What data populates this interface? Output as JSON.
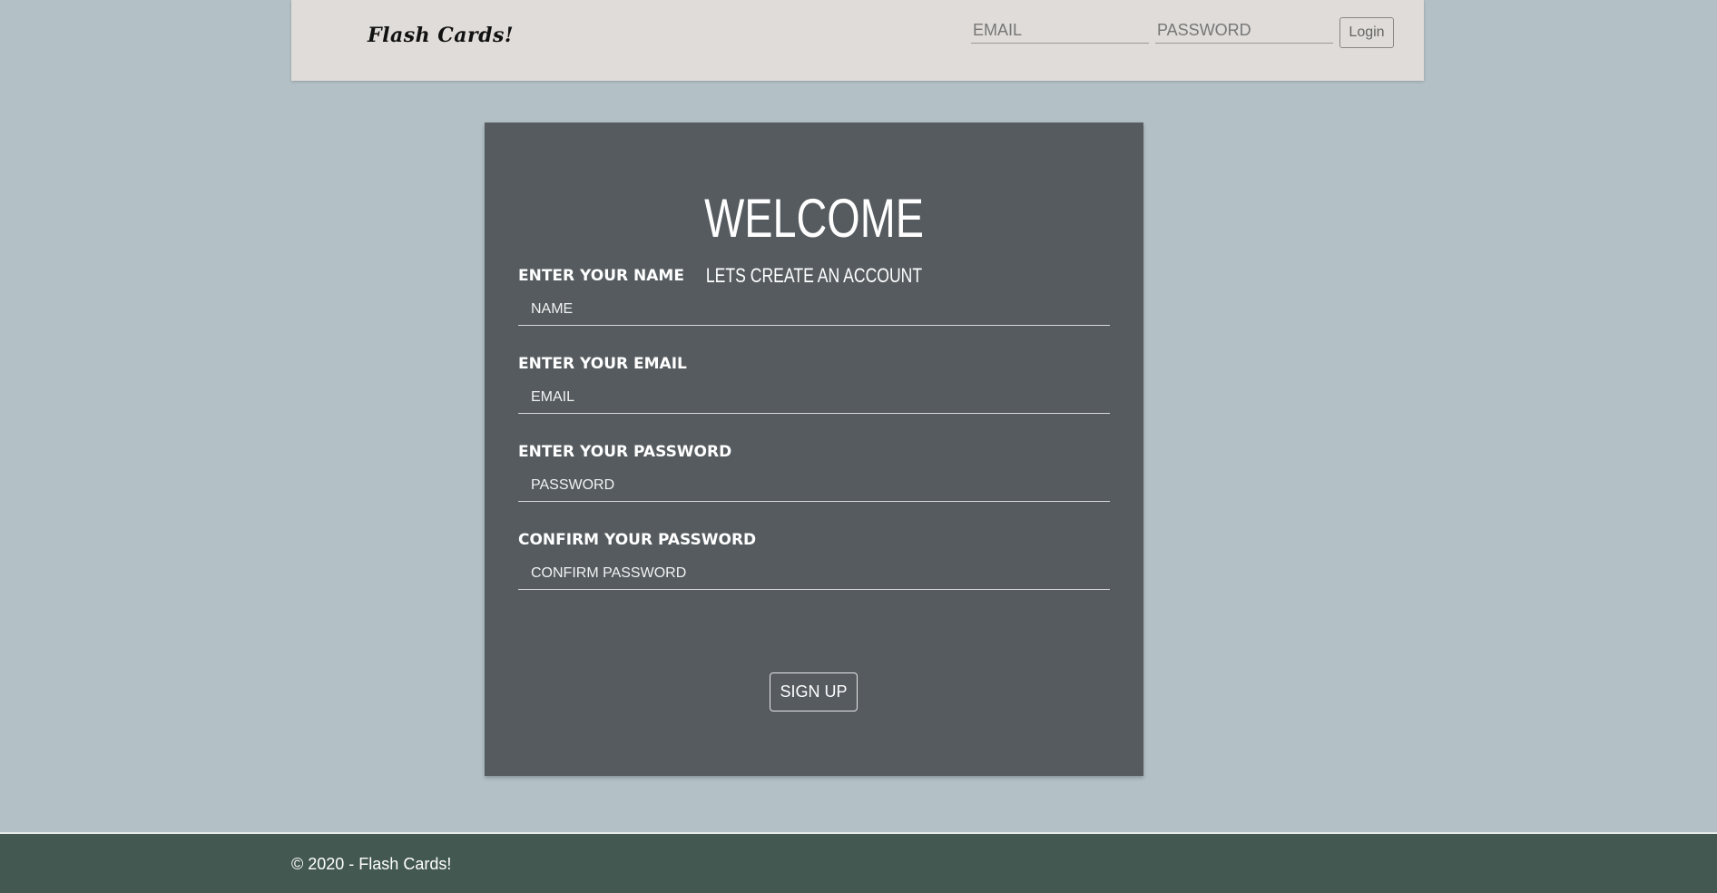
{
  "navbar": {
    "brand": "Flash Cards!",
    "email_placeholder": "EMAIL",
    "password_placeholder": "PASSWORD",
    "login_label": "Login"
  },
  "signup": {
    "title": "WELCOME",
    "subtitle": "LETS CREATE AN ACCOUNT",
    "fields": [
      {
        "label": "ENTER YOUR NAME",
        "placeholder": "NAME"
      },
      {
        "label": "ENTER YOUR EMAIL",
        "placeholder": "EMAIL"
      },
      {
        "label": "ENTER YOUR PASSWORD",
        "placeholder": "PASSWORD"
      },
      {
        "label": "CONFIRM YOUR PASSWORD",
        "placeholder": "CONFIRM PASSWORD"
      }
    ],
    "button_label": "SIGN UP"
  },
  "footer": {
    "text": "© 2020 - Flash Cards!"
  },
  "colors": {
    "page_background": "#b3c1c7",
    "navbar_background": "#dfdcd9",
    "card_background": "#555b5f",
    "footer_background": "#435851"
  }
}
